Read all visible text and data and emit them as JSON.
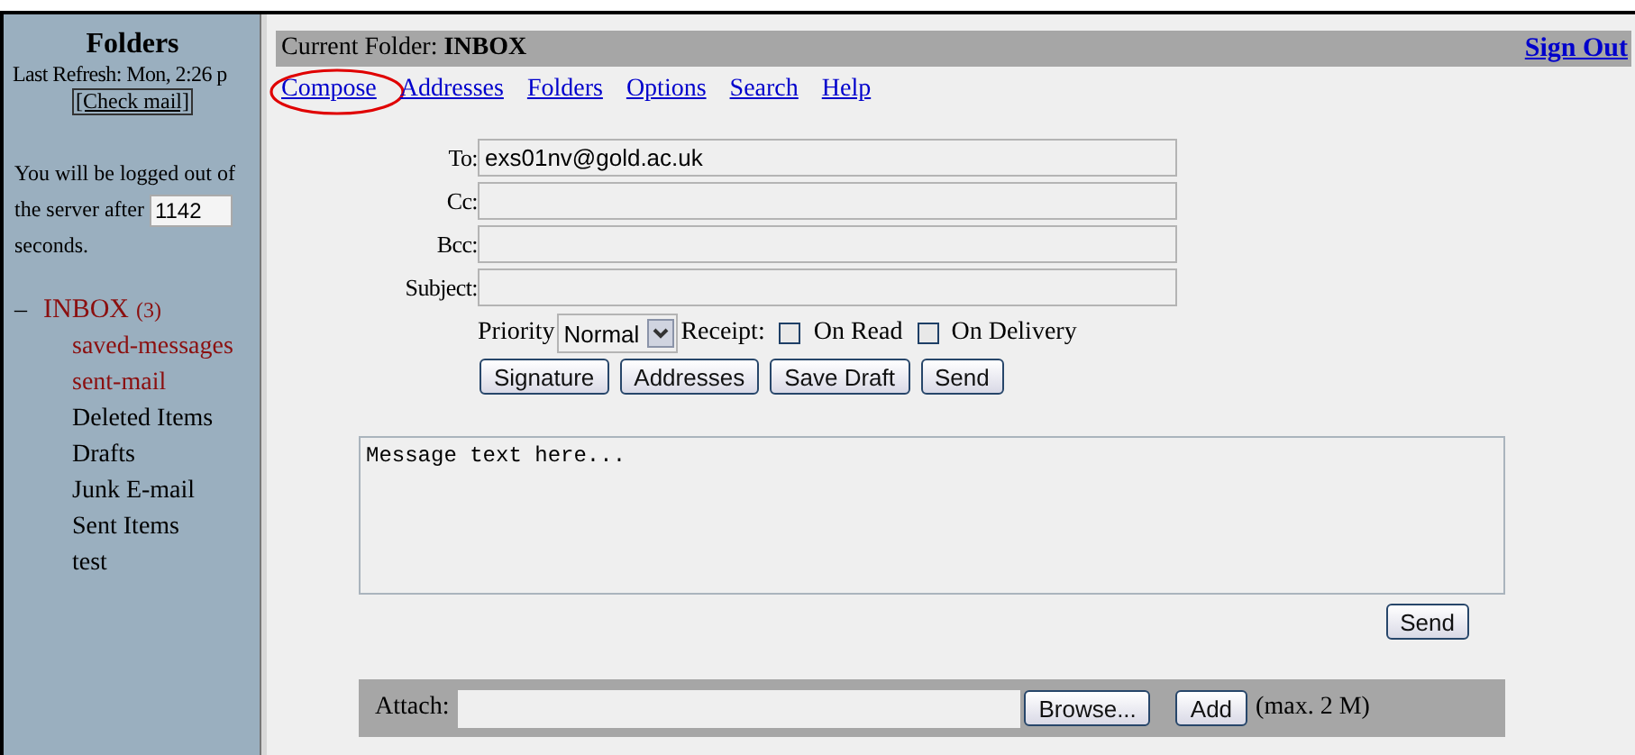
{
  "sidebar": {
    "title": "Folders",
    "last_refresh": "Last Refresh: Mon, 2:26 p",
    "check_mail": "[Check mail]",
    "logout_text": [
      "You will be logged out of",
      "the server after"
    ],
    "logout_seconds": "1142",
    "logout_unit": "seconds.",
    "folders": [
      {
        "name": "INBOX",
        "toggle": "–",
        "count": "(3)",
        "expanded": true,
        "highlighted": true,
        "children": [
          {
            "name": "saved-messages",
            "highlighted": true
          },
          {
            "name": "sent-mail",
            "highlighted": true
          },
          {
            "name": "Deleted Items",
            "highlighted": false
          },
          {
            "name": "Drafts",
            "highlighted": false
          },
          {
            "name": "Junk E-mail",
            "highlighted": false
          },
          {
            "name": "Sent Items",
            "highlighted": false
          },
          {
            "name": "test",
            "highlighted": false
          }
        ]
      }
    ]
  },
  "header": {
    "label": "Current Folder:",
    "folder": "INBOX",
    "sign_out": "Sign Out"
  },
  "nav": [
    {
      "label": "Compose",
      "circled": true
    },
    {
      "label": "Addresses",
      "circled": false
    },
    {
      "label": "Folders",
      "circled": false
    },
    {
      "label": "Options",
      "circled": false
    },
    {
      "label": "Search",
      "circled": false
    },
    {
      "label": "Help",
      "circled": false
    }
  ],
  "fields": [
    {
      "label": "To:",
      "value": "exs01nv@gold.ac.uk"
    },
    {
      "label": "Cc:"
    },
    {
      "label": "Bcc:"
    },
    {
      "label": "Subject:"
    }
  ],
  "priority": {
    "label": "Priority",
    "value": "Normal"
  },
  "receipt": {
    "label": "Receipt:",
    "options": [
      {
        "label": "On Read",
        "checked": false
      },
      {
        "label": "On Delivery",
        "checked": false
      }
    ]
  },
  "buttons": [
    "Signature",
    "Addresses",
    "Save Draft",
    "Send"
  ],
  "message": {
    "value": "Message text here..."
  },
  "send_button": "Send",
  "attach": {
    "label": "Attach:",
    "browse": "Browse...",
    "add": "Add",
    "limit": "(max. 2 M)"
  }
}
